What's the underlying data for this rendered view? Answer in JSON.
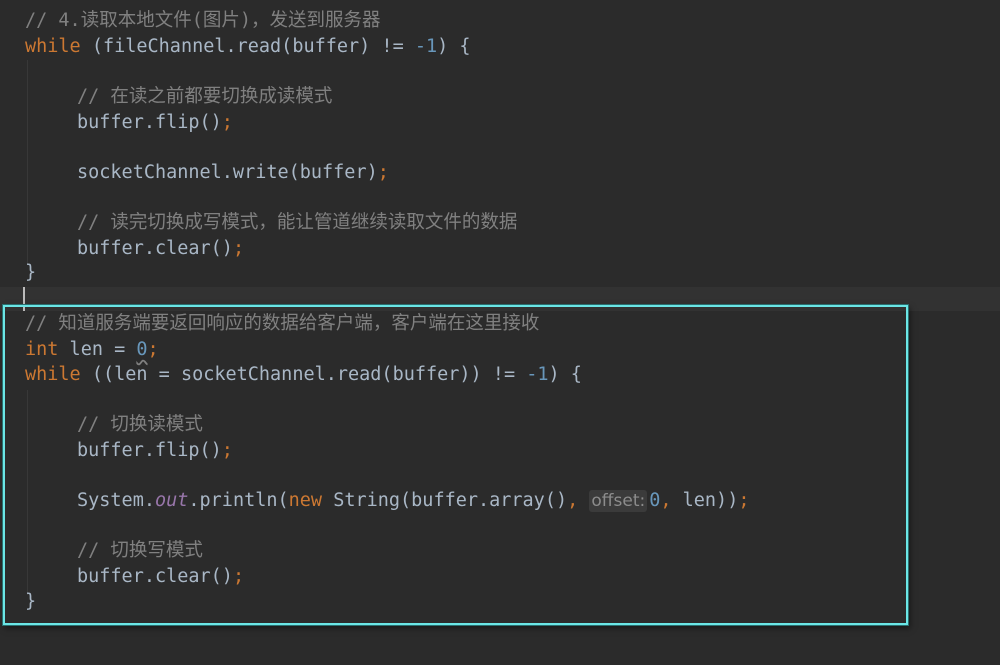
{
  "editor": {
    "theme_colors": {
      "background": "#2b2b2b",
      "keyword": "#cc7832",
      "comment": "#808080",
      "number": "#6897bb",
      "identifier": "#a9b7c6",
      "static_field": "#9876aa",
      "highlight_border": "#6be6e6"
    },
    "block1": {
      "comment1": "// 4.读取本地文件(图片)，发送到服务器",
      "while_kw": "while",
      "while_rest": " (fileChannel.read(buffer) != ",
      "minus_one": "-1",
      "while_end": ") {",
      "comment2": "// 在读之前都要切换成读模式",
      "flip": "buffer.flip()",
      "write": "socketChannel.write(buffer)",
      "comment3": "// 读完切换成写模式，能让管道继续读取文件的数据",
      "clear": "buffer.clear()",
      "close_brace": "}"
    },
    "block2": {
      "comment1": "// 知道服务端要返回响应的数据给客户端，客户端在这里接收",
      "int_kw": "int",
      "len_decl": " len = ",
      "zero": "0",
      "while_kw": "while",
      "while_rest": " ((len = socketChannel.read(buffer)) != ",
      "minus_one": "-1",
      "while_end": ") {",
      "comment2": "// 切换读模式",
      "flip": "buffer.flip()",
      "println_system": "System.",
      "println_out": "out",
      "println_mid": ".println(",
      "new_kw": "new",
      "string_call": " String(buffer.array()",
      "comma": ",",
      "param_hint": "offset:",
      "offset_value": "0",
      "len_end": " len))",
      "comment3": "// 切换写模式",
      "clear": "buffer.clear()",
      "close_brace": "}"
    },
    "semicolon": ";"
  }
}
